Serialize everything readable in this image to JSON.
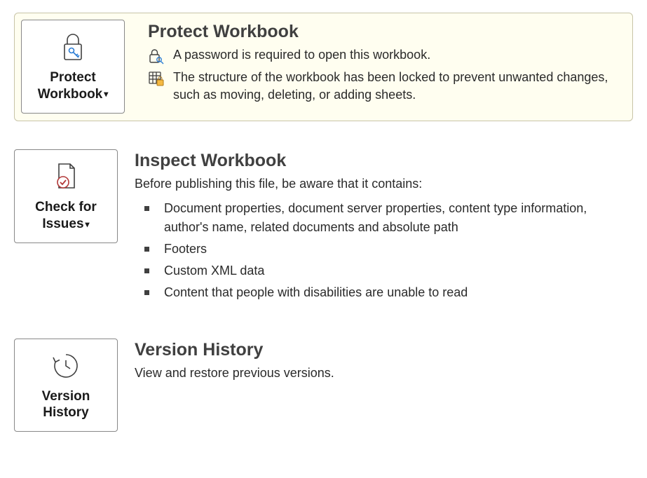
{
  "protect": {
    "button_label_line1": "Protect",
    "button_label_line2": "Workbook",
    "title": "Protect Workbook",
    "status1": "A password is required to open this workbook.",
    "status2": "The structure of the workbook has been locked to prevent unwanted changes, such as moving, deleting, or adding sheets."
  },
  "inspect": {
    "button_label_line1": "Check for",
    "button_label_line2": "Issues",
    "title": "Inspect Workbook",
    "intro": "Before publishing this file, be aware that it contains:",
    "items": [
      "Document properties, document server properties, content type information, author's name, related documents and absolute path",
      "Footers",
      "Custom XML data",
      "Content that people with disabilities are unable to read"
    ]
  },
  "version": {
    "button_label_line1": "Version",
    "button_label_line2": "History",
    "title": "Version History",
    "desc": "View and restore previous versions."
  }
}
